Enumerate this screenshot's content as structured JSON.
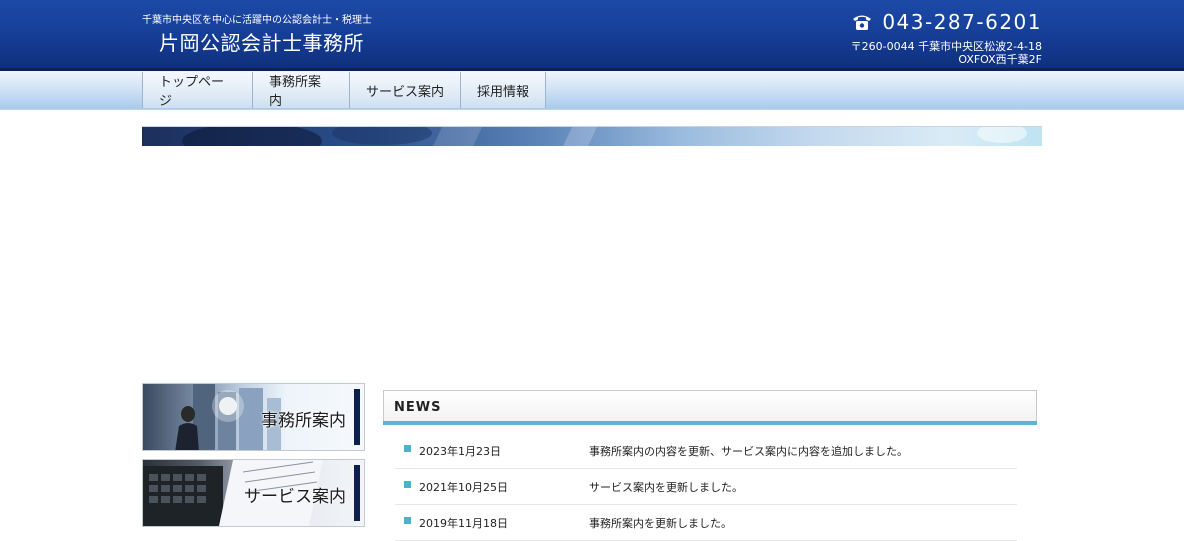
{
  "header": {
    "tagline": "千葉市中央区を中心に活躍中の公認会計士・税理士",
    "title": "片岡公認会計士事務所",
    "phone": "043-287-6201",
    "address_line1": "〒260-0044 千葉市中央区松波2-4-18",
    "address_line2": "OXFOX西千葉2F"
  },
  "nav": {
    "items": [
      {
        "label": "トップページ"
      },
      {
        "label": "事務所案内"
      },
      {
        "label": "サービス案内"
      },
      {
        "label": "採用情報"
      }
    ]
  },
  "sidebar": {
    "office_label": "事務所案内",
    "service_label": "サービス案内"
  },
  "news": {
    "title": "NEWS",
    "items": [
      {
        "date": "2023年1月23日",
        "text": "事務所案内の内容を更新、サービス案内に内容を追加しました。"
      },
      {
        "date": "2021年10月25日",
        "text": "サービス案内を更新しました。"
      },
      {
        "date": "2019年11月18日",
        "text": "事務所案内を更新しました。"
      }
    ]
  },
  "colors": {
    "header_blue": "#163f98",
    "news_accent": "#56b7cf"
  },
  "icons": {
    "phone": "phone-icon"
  }
}
